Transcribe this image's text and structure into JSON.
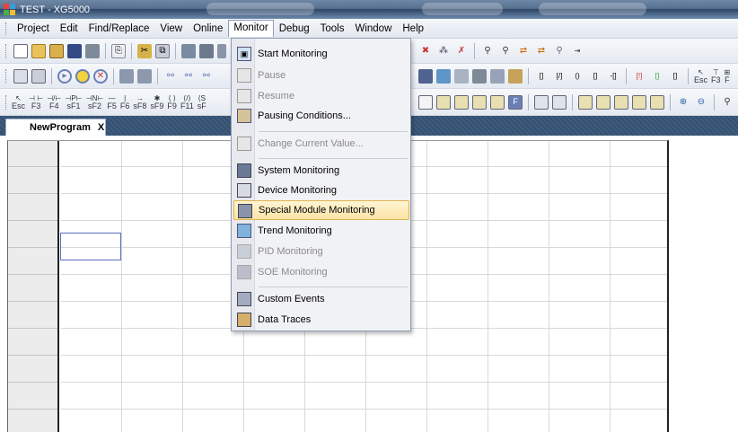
{
  "window": {
    "title": "TEST - XG5000"
  },
  "menubar": {
    "items": [
      "Project",
      "Edit",
      "Find/Replace",
      "View",
      "Online",
      "Monitor",
      "Debug",
      "Tools",
      "Window",
      "Help"
    ],
    "active": "Monitor"
  },
  "toolbar3": {
    "fkeys": [
      {
        "sym": "↖",
        "key": "Esc"
      },
      {
        "sym": "⊣ ⊢",
        "key": "F3"
      },
      {
        "sym": "⊣/⊢",
        "key": "F4"
      },
      {
        "sym": "⊣P⊢",
        "key": "sF1"
      },
      {
        "sym": "⊣N⊢",
        "key": "sF2"
      },
      {
        "sym": "—",
        "key": "F5"
      },
      {
        "sym": "|",
        "key": "F6"
      },
      {
        "sym": "→",
        "key": "sF8"
      },
      {
        "sym": "✱",
        "key": "sF9"
      },
      {
        "sym": "⟨ ⟩",
        "key": "F9"
      },
      {
        "sym": "⟨/⟩",
        "key": "F11"
      },
      {
        "sym": "⟨S",
        "key": "sF"
      }
    ],
    "right_fkeys": [
      {
        "sym": "↖",
        "key": "Esc"
      },
      {
        "sym": "⊤",
        "key": "F3"
      },
      {
        "sym": "⊞",
        "key": "F"
      }
    ]
  },
  "doc_tab": {
    "label": "NewProgram",
    "close": "X"
  },
  "monitor_menu": {
    "items": [
      {
        "label": "Start Monitoring",
        "icon": "start-monitoring-icon",
        "disabled": false
      },
      {
        "label": "Pause",
        "icon": "pause-icon",
        "disabled": true
      },
      {
        "label": "Resume",
        "icon": "resume-icon",
        "disabled": true
      },
      {
        "label": "Pausing Conditions...",
        "icon": "pausing-conditions-icon",
        "disabled": false
      },
      {
        "label": "Change Current Value...",
        "icon": "change-value-icon",
        "disabled": true
      },
      {
        "label": "System Monitoring",
        "icon": "system-monitoring-icon",
        "disabled": false
      },
      {
        "label": "Device Monitoring",
        "icon": "device-monitoring-icon",
        "disabled": false
      },
      {
        "label": "Special Module Monitoring",
        "icon": "special-module-icon",
        "disabled": false,
        "highlighted": true
      },
      {
        "label": "Trend Monitoring",
        "icon": "trend-monitoring-icon",
        "disabled": false
      },
      {
        "label": "PID Monitoring",
        "icon": "pid-monitoring-icon",
        "disabled": true
      },
      {
        "label": "SOE Monitoring",
        "icon": "soe-monitoring-icon",
        "disabled": true
      },
      {
        "label": "Custom Events",
        "icon": "custom-events-icon",
        "disabled": false
      },
      {
        "label": "Data Traces",
        "icon": "data-traces-icon",
        "disabled": false
      }
    ]
  },
  "colors": {
    "highlight": "#fde4a6",
    "highlight_border": "#e0b552",
    "tabstrip": "#3e5c7e",
    "cursor": "#5a6ec0"
  }
}
